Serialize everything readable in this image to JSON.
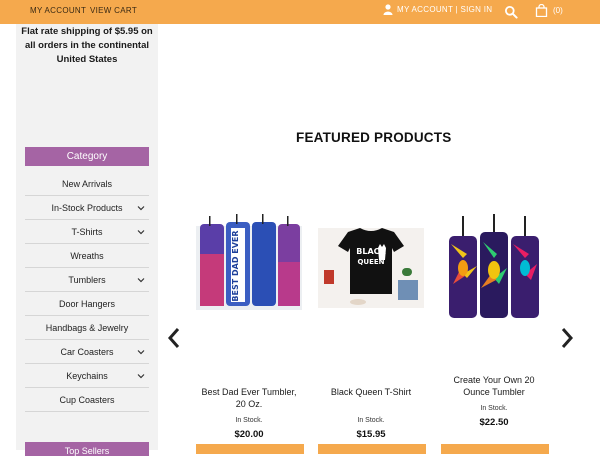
{
  "topbar": {
    "my_account": "MY ACCOUNT",
    "view_cart": "VIEW CART",
    "account_signin": "MY ACCOUNT | SIGN IN",
    "cart_count": "(0)"
  },
  "sidebar": {
    "shipping": "Flat rate shipping of $5.95 on all orders in the continental United States",
    "category_heading": "Category",
    "categories": [
      {
        "label": "New Arrivals",
        "has_submenu": false
      },
      {
        "label": "In-Stock Products",
        "has_submenu": true
      },
      {
        "label": "T-Shirts",
        "has_submenu": true
      },
      {
        "label": "Wreaths",
        "has_submenu": false
      },
      {
        "label": "Tumblers",
        "has_submenu": true
      },
      {
        "label": "Door Hangers",
        "has_submenu": false
      },
      {
        "label": "Handbags & Jewelry",
        "has_submenu": false
      },
      {
        "label": "Car Coasters",
        "has_submenu": true
      },
      {
        "label": "Keychains",
        "has_submenu": true
      },
      {
        "label": "Cup Coasters",
        "has_submenu": false
      }
    ],
    "top_heading": "Top Sellers"
  },
  "main": {
    "featured_title": "FEATURED PRODUCTS",
    "products": [
      {
        "name": "Best Dad Ever Tumbler, 20 Oz.",
        "stock": "In Stock.",
        "price": "$20.00",
        "image_text": "BEST DAD EVER"
      },
      {
        "name": "Black Queen T-Shirt",
        "stock": "In Stock.",
        "price": "$15.95",
        "image_text": "BLACK QUEEN"
      },
      {
        "name": "Create Your Own 20 Ounce Tumbler",
        "stock": "In Stock.",
        "price": "$22.50",
        "image_text": ""
      }
    ]
  },
  "colors": {
    "accent_orange": "#f5a94d",
    "category_purple": "#a564a4",
    "sidebar_bg": "#f2f2f2"
  }
}
